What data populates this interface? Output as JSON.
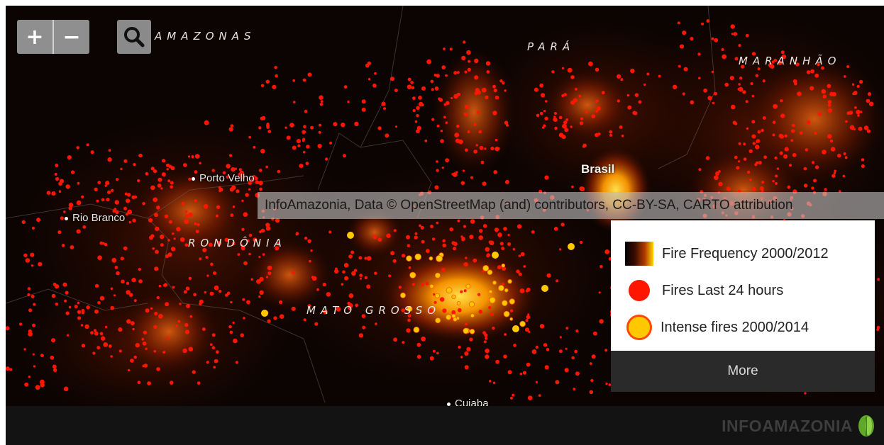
{
  "map": {
    "region_labels": [
      "AMAZONAS",
      "PARÁ",
      "MARANHÃO",
      "RONDÔNIA",
      "MATO GROSSO"
    ],
    "city_labels": [
      "Porto Velho",
      "Rio Branco",
      "Cuiaba"
    ],
    "country_label": "Brasil",
    "colors": {
      "background": "#0b0402",
      "fire_24h": "#ff1600",
      "intense": "#ffc800",
      "heat_low": "#3a0c00",
      "heat_high": "#ffd600"
    }
  },
  "controls": {
    "zoom_in_label": "+",
    "zoom_out_label": "−",
    "search_icon": "magnifier-icon"
  },
  "attribution": "InfoAmazonia, Data © OpenStreetMap (and) contributors, CC-BY-SA, CARTO attribution",
  "legend": {
    "items": [
      {
        "label": "Fire Frequency 2000/2012",
        "swatch": "gradient"
      },
      {
        "label": "Fires Last 24 hours",
        "swatch": "red-dot"
      },
      {
        "label": "Intense fires 2000/2014",
        "swatch": "yellow-dot"
      }
    ],
    "more_label": "More"
  },
  "footer": {
    "brand": "INFOAMAZONIA",
    "brand_icon": "leaf-icon"
  }
}
